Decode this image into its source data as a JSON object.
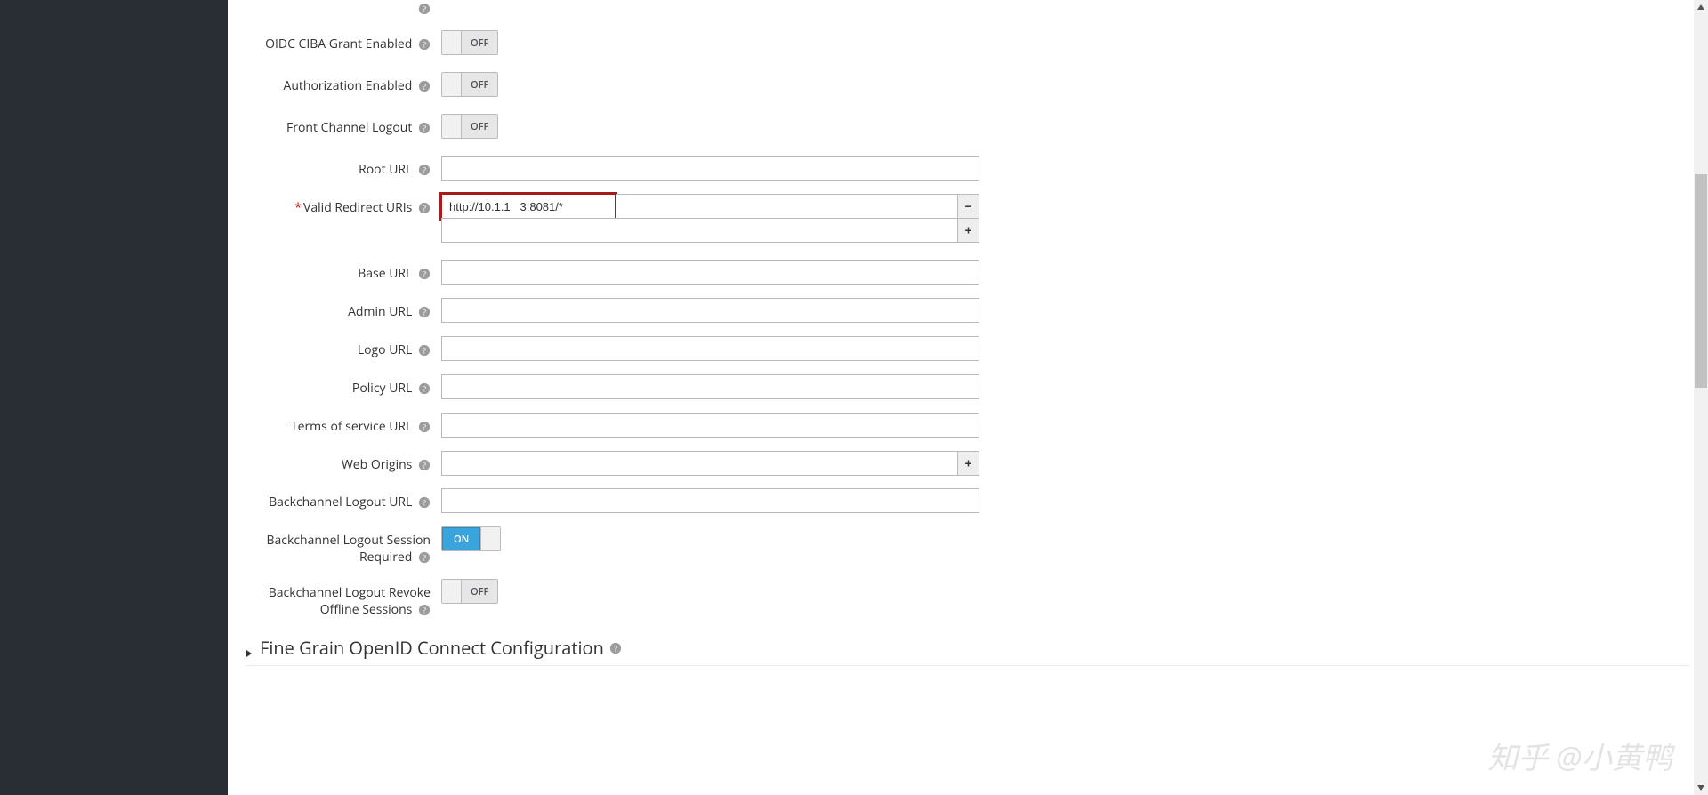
{
  "form": {
    "oidcCiba": {
      "label": "OIDC CIBA Grant Enabled",
      "state": "OFF"
    },
    "authEnabled": {
      "label": "Authorization Enabled",
      "state": "OFF"
    },
    "frontChannel": {
      "label": "Front Channel Logout",
      "state": "OFF"
    },
    "rootUrl": {
      "label": "Root URL",
      "value": ""
    },
    "validRedirect": {
      "label": "Valid Redirect URIs",
      "values": [
        "http://10.1.1   3:8081/*"
      ]
    },
    "baseUrl": {
      "label": "Base URL",
      "value": ""
    },
    "adminUrl": {
      "label": "Admin URL",
      "value": ""
    },
    "logoUrl": {
      "label": "Logo URL",
      "value": ""
    },
    "policyUrl": {
      "label": "Policy URL",
      "value": ""
    },
    "tosUrl": {
      "label": "Terms of service URL",
      "value": ""
    },
    "webOrigins": {
      "label": "Web Origins",
      "value": ""
    },
    "backchannelLogoutUrl": {
      "label": "Backchannel Logout URL",
      "value": ""
    },
    "backchannelSession": {
      "label": "Backchannel Logout Session Required",
      "state": "ON"
    },
    "backchannelRevoke": {
      "label": "Backchannel Logout Revoke Offline Sessions",
      "state": "OFF"
    }
  },
  "section": {
    "title": "Fine Grain OpenID Connect Configuration"
  },
  "watermark": "知乎 @小黄鸭"
}
